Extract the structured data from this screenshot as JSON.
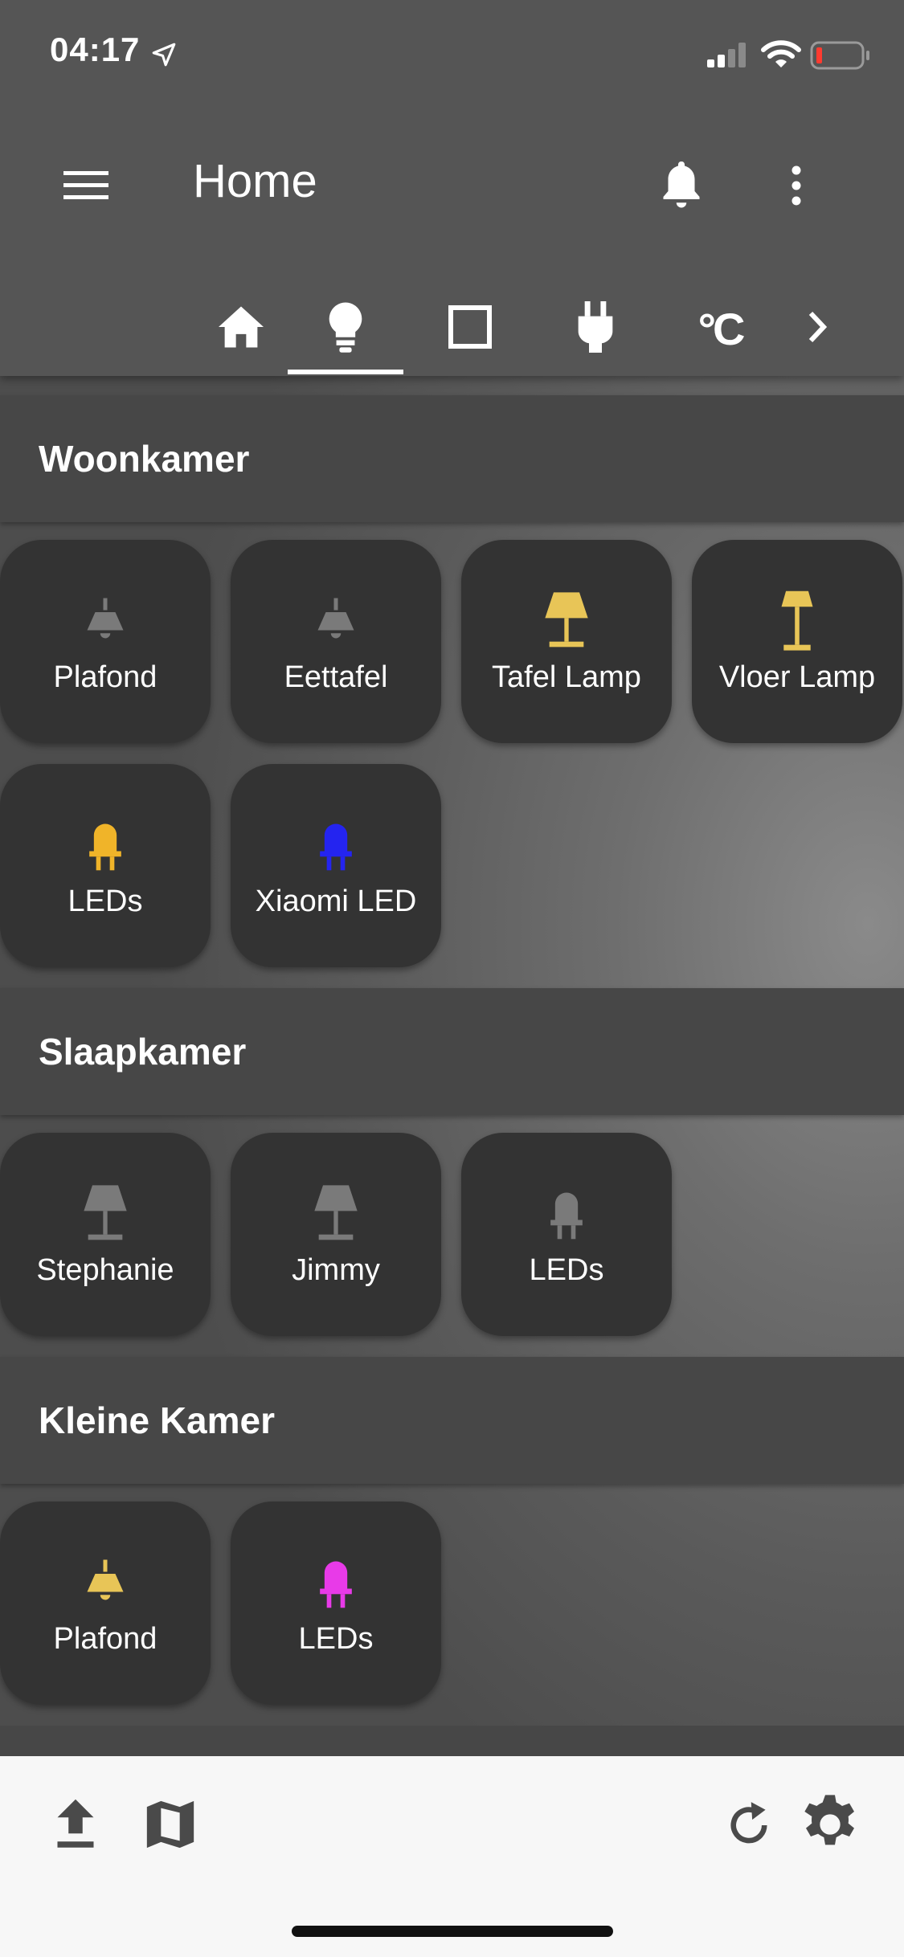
{
  "status_bar": {
    "time": "04:17",
    "icons": [
      "location-arrow-icon",
      "cellular-signal-icon",
      "wifi-icon",
      "battery-low-icon"
    ]
  },
  "app_bar": {
    "title": "Home",
    "menu_icon": "hamburger-menu-icon",
    "notification_icon": "bell-icon",
    "overflow_icon": "more-vertical-icon"
  },
  "tabs": {
    "items": [
      {
        "icon": "home-icon"
      },
      {
        "icon": "lightbulb-icon",
        "selected": true
      },
      {
        "icon": "square-icon"
      },
      {
        "icon": "plug-icon"
      },
      {
        "icon": "celsius-icon"
      },
      {
        "icon": "chevron-right-icon"
      }
    ],
    "celsius_glyph": "°C"
  },
  "sections": [
    {
      "title": "Woonkamer",
      "tiles": [
        {
          "label": "Plafond",
          "icon": "ceiling-lamp-icon",
          "color": "#7a7a7a"
        },
        {
          "label": "Eettafel",
          "icon": "ceiling-lamp-icon",
          "color": "#7a7a7a"
        },
        {
          "label": "Tafel Lamp",
          "icon": "table-lamp-icon",
          "color": "#e8c557"
        },
        {
          "label": "Vloer Lamp",
          "icon": "floor-lamp-icon",
          "color": "#e8c557"
        },
        {
          "label": "LEDs",
          "icon": "led-icon",
          "color": "#f0b429"
        },
        {
          "label": "Xiaomi LED",
          "icon": "led-icon",
          "color": "#2424f0"
        }
      ]
    },
    {
      "title": "Slaapkamer",
      "tiles": [
        {
          "label": "Stephanie",
          "icon": "table-lamp-icon",
          "color": "#7a7a7a"
        },
        {
          "label": "Jimmy",
          "icon": "table-lamp-icon",
          "color": "#7a7a7a"
        },
        {
          "label": "LEDs",
          "icon": "led-icon",
          "color": "#7a7a7a"
        }
      ]
    },
    {
      "title": "Kleine Kamer",
      "tiles": [
        {
          "label": "Plafond",
          "icon": "ceiling-lamp-icon",
          "color": "#e8c557"
        },
        {
          "label": "LEDs",
          "icon": "led-icon",
          "color": "#e83ae8"
        }
      ]
    }
  ],
  "bottom_bar": {
    "left_icons": [
      "upload-icon",
      "map-icon"
    ],
    "right_icons": [
      "refresh-icon",
      "settings-gear-icon"
    ]
  }
}
